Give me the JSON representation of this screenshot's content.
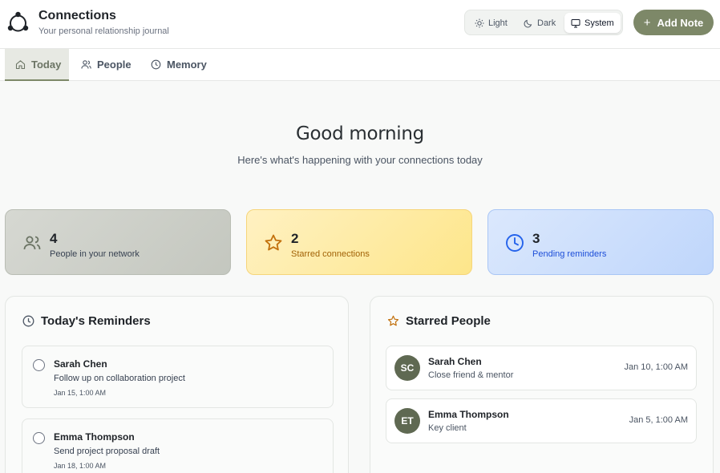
{
  "app": {
    "title": "Connections",
    "subtitle": "Your personal relationship journal"
  },
  "theme": {
    "options": [
      "Light",
      "Dark",
      "System"
    ],
    "selected": "System"
  },
  "actions": {
    "add_note": "Add Note"
  },
  "tabs": [
    {
      "label": "Today",
      "icon": "home-icon",
      "active": true
    },
    {
      "label": "People",
      "icon": "users-icon",
      "active": false
    },
    {
      "label": "Memory",
      "icon": "clock-icon",
      "active": false
    }
  ],
  "greeting": {
    "title": "Good morning",
    "subtitle": "Here's what's happening with your connections today"
  },
  "stats": [
    {
      "value": "4",
      "label": "People in your network",
      "icon": "users-icon",
      "color": "#6b7464"
    },
    {
      "value": "2",
      "label": "Starred connections",
      "icon": "star-icon",
      "color": "#c2700c"
    },
    {
      "value": "3",
      "label": "Pending reminders",
      "icon": "clock-icon",
      "color": "#2563eb"
    }
  ],
  "reminders_panel": {
    "title": "Today's Reminders",
    "items": [
      {
        "name": "Sarah Chen",
        "note": "Follow up on collaboration project",
        "date": "Jan 15, 1:00 AM"
      },
      {
        "name": "Emma Thompson",
        "note": "Send project proposal draft",
        "date": "Jan 18, 1:00 AM"
      }
    ]
  },
  "starred_panel": {
    "title": "Starred People",
    "items": [
      {
        "initials": "SC",
        "name": "Sarah Chen",
        "note": "Close friend & mentor",
        "date": "Jan 10, 1:00 AM"
      },
      {
        "initials": "ET",
        "name": "Emma Thompson",
        "note": "Key client",
        "date": "Jan 5, 1:00 AM"
      }
    ]
  },
  "colors": {
    "accent": "#7d8868",
    "starred": "#c2700c",
    "pending": "#2563eb"
  }
}
